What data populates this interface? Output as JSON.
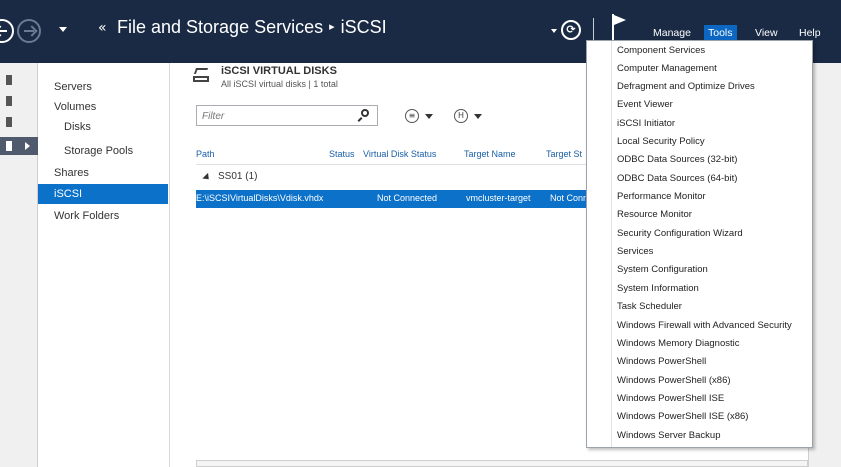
{
  "header": {
    "breadcrumb_arrows": "«",
    "title_parent": "File and Storage Services",
    "title_separator": "▸",
    "title_current": "iSCSI",
    "refresh_glyph": "⟳",
    "menu": [
      "Manage",
      "Tools",
      "View",
      "Help"
    ],
    "active_menu": "Tools"
  },
  "sidebar": {
    "items": [
      {
        "label": "Servers"
      },
      {
        "label": "Volumes"
      },
      {
        "label": "Disks"
      },
      {
        "label": "Storage Pools"
      },
      {
        "label": "Shares"
      },
      {
        "label": "iSCSI"
      },
      {
        "label": "Work Folders"
      }
    ],
    "selected": "iSCSI"
  },
  "section": {
    "title": "iSCSI VIRTUAL DISKS",
    "subtitle": "All iSCSI virtual disks | 1 total"
  },
  "filter": {
    "placeholder": "Filter"
  },
  "toolbar": {
    "list_view_glyph": "≡",
    "save_glyph": "H"
  },
  "table": {
    "columns": [
      "Path",
      "Status",
      "Virtual Disk Status",
      "Target Name",
      "Target St"
    ],
    "group": "SS01 (1)",
    "rows": [
      {
        "path": "E:\\iSCSIVirtualDisks\\Vdisk.vhdx",
        "status": "",
        "virtual_disk_status": "Not Connected",
        "target_name": "vmcluster-target",
        "target_status": "Not Conn"
      }
    ]
  },
  "tools_menu": {
    "items": [
      "Component Services",
      "Computer Management",
      "Defragment and Optimize Drives",
      "Event Viewer",
      "iSCSI Initiator",
      "Local Security Policy",
      "ODBC Data Sources (32-bit)",
      "ODBC Data Sources (64-bit)",
      "Performance Monitor",
      "Resource Monitor",
      "Security Configuration Wizard",
      "Services",
      "System Configuration",
      "System Information",
      "Task Scheduler",
      "Windows Firewall with Advanced Security",
      "Windows Memory Diagnostic",
      "Windows PowerShell",
      "Windows PowerShell (x86)",
      "Windows PowerShell ISE",
      "Windows PowerShell ISE (x86)",
      "Windows Server Backup"
    ]
  },
  "colors": {
    "titlebar": "#1a2a44",
    "selection": "#0c71c9",
    "menu_active": "#0b67c2"
  }
}
